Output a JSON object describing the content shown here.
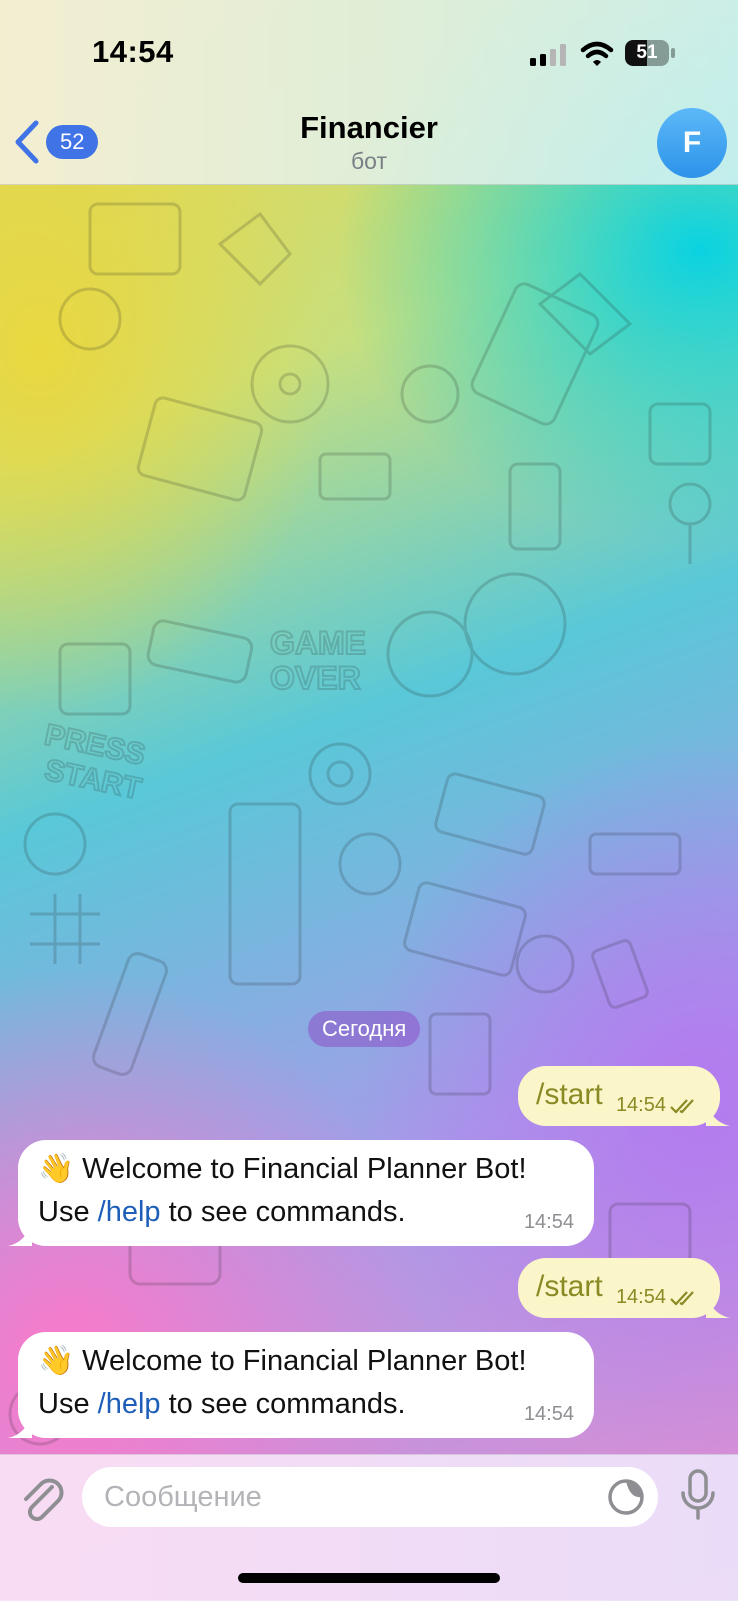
{
  "status_bar": {
    "time": "14:54",
    "battery": "51",
    "battery_level": 0.51
  },
  "header": {
    "back_badge": "52",
    "title": "Financier",
    "subtitle": "бот",
    "avatar_letter": "F"
  },
  "date_separator": "Сегодня",
  "messages": [
    {
      "direction": "outgoing",
      "text": "/start",
      "time": "14:54",
      "status": "read"
    },
    {
      "direction": "incoming",
      "emoji": "👋",
      "line1": "Welcome to Financial Planner Bot!",
      "line2_pre": "Use ",
      "line2_cmd": "/help",
      "line2_post": " to see commands.",
      "time": "14:54"
    },
    {
      "direction": "outgoing",
      "text": "/start",
      "time": "14:54",
      "status": "read"
    },
    {
      "direction": "incoming",
      "emoji": "👋",
      "line1": "Welcome to Financial Planner Bot!",
      "line2_pre": "Use ",
      "line2_cmd": "/help",
      "line2_post": " to see commands.",
      "time": "14:54"
    }
  ],
  "input": {
    "placeholder": "Сообщение",
    "value": ""
  },
  "icons": {
    "back": "chevron-left-icon",
    "attach": "paperclip-icon",
    "sticker": "sticker-icon",
    "mic": "microphone-icon",
    "read": "double-check-icon"
  },
  "colors": {
    "accent": "#3f73e6",
    "outgoing_bubble": "#fbf6c9",
    "outgoing_text": "#8a8a25",
    "link": "#1d5fb8",
    "date_pill": "#9a5cc8"
  }
}
